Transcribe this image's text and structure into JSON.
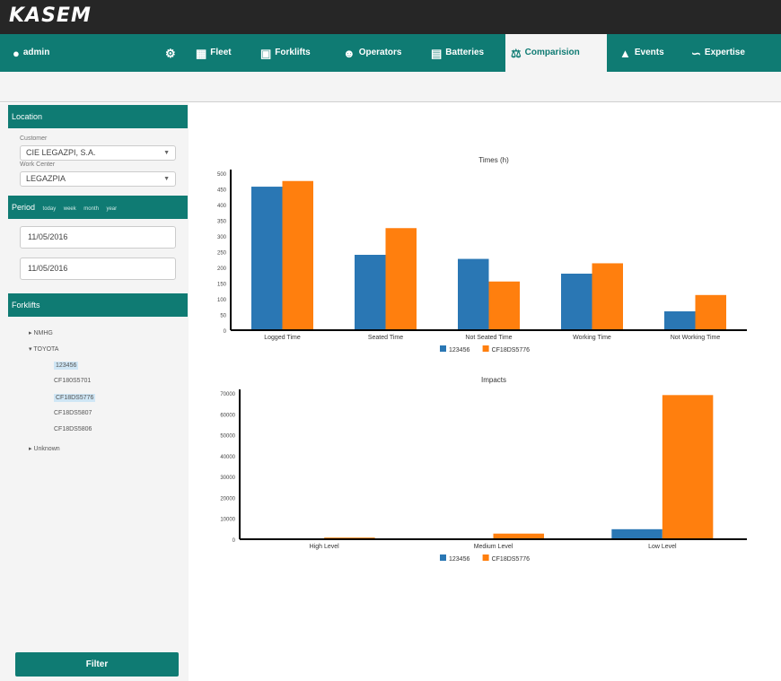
{
  "app": {
    "logo": "KASEM"
  },
  "nav": {
    "user": "admin",
    "items": [
      {
        "label": "Fleet",
        "icon": "grid-icon"
      },
      {
        "label": "Forklifts",
        "icon": "forklift-icon"
      },
      {
        "label": "Operators",
        "icon": "user-icon"
      },
      {
        "label": "Batteries",
        "icon": "battery-icon"
      },
      {
        "label": "Comparision",
        "icon": "scale-icon"
      },
      {
        "label": "Events",
        "icon": "bell-icon"
      },
      {
        "label": "Expertise",
        "icon": "chart-icon"
      }
    ],
    "active": "Comparision"
  },
  "sidebar": {
    "location_title": "Location",
    "customer_label": "Customer",
    "customer_value": "CIE LEGAZPI, S.A.",
    "work_center_label": "Work Center",
    "work_center_value": "LEGAZPIA",
    "period_title": "Period",
    "period_options": [
      "today",
      "week",
      "month",
      "year"
    ],
    "date_from": "11/05/2016",
    "date_to": "11/05/2016",
    "forklifts_title": "Forklifts",
    "tree": [
      "NMHG",
      "TOYOTA",
      "123456",
      "CF180S5701",
      "CF18DS5776",
      "CF18DS5807",
      "CF18DS5806",
      "Unknown"
    ],
    "filter_label": "Filter"
  },
  "accent_color": "#0f7b73",
  "series_colors": [
    "#2a77b4",
    "#ff7f0e"
  ],
  "chart_data": [
    {
      "type": "bar",
      "title": "Times (h)",
      "categories": [
        "Logged Time",
        "Seated Time",
        "Not Seated Time",
        "Working Time",
        "Not Working Time"
      ],
      "series": [
        {
          "name": "123456",
          "values": [
            457,
            240,
            227,
            180,
            60
          ]
        },
        {
          "name": "CF18DS5776",
          "values": [
            475,
            325,
            155,
            213,
            112
          ]
        }
      ],
      "ylim": [
        0,
        500
      ],
      "yticks": [
        0,
        50,
        100,
        150,
        200,
        250,
        300,
        350,
        400,
        450,
        500
      ],
      "legend": "bottom-center"
    },
    {
      "type": "bar",
      "title": "Impacts",
      "categories": [
        "High Level",
        "Medium Level",
        "Low Level"
      ],
      "series": [
        {
          "name": "123456",
          "values": [
            300,
            300,
            4800
          ]
        },
        {
          "name": "CF18DS5776",
          "values": [
            800,
            2700,
            69000
          ]
        }
      ],
      "ylim": [
        0,
        70000
      ],
      "yticks": [
        0,
        10000,
        20000,
        30000,
        40000,
        50000,
        60000,
        70000
      ],
      "legend": "bottom-center"
    }
  ]
}
